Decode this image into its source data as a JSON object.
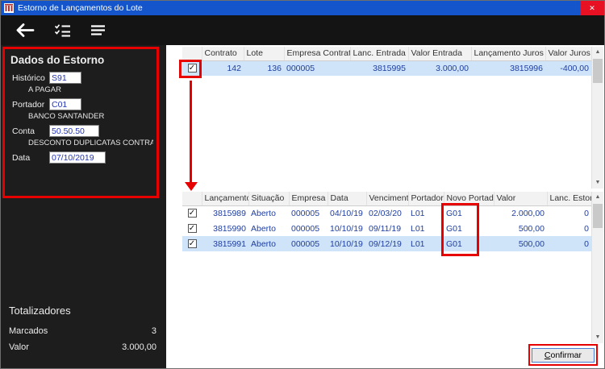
{
  "window": {
    "title": "Estorno de Lançamentos do Lote"
  },
  "icons": {
    "close": "✕",
    "check": "✓",
    "scroll_up": "▲",
    "scroll_down": "▼"
  },
  "sidebar": {
    "section_title": "Dados do Estorno",
    "fields": [
      {
        "label": "Histórico",
        "value": "S91",
        "desc": "A PAGAR"
      },
      {
        "label": "Portador",
        "value": "C01",
        "desc": "BANCO SANTANDER"
      },
      {
        "label": "Conta",
        "value": "50.50.50",
        "desc": "DESCONTO DUPLICATAS CONTRATO BAN"
      },
      {
        "label": "Data",
        "value": "07/10/2019",
        "desc": ""
      }
    ],
    "totals": {
      "title": "Totalizadores",
      "marcados_label": "Marcados",
      "marcados_value": "3",
      "valor_label": "Valor",
      "valor_value": "3.000,00"
    }
  },
  "top_grid": {
    "columns": [
      "",
      "Contrato",
      "Lote",
      "Empresa Contrato",
      "Lanc. Entrada",
      "Valor Entrada",
      "Lançamento Juros",
      "Valor Juros"
    ],
    "rows": [
      {
        "checked": true,
        "selected": true,
        "cells": [
          "142",
          "136",
          "000005",
          "3815995",
          "3.000,00",
          "3815996",
          "-400,00"
        ]
      }
    ]
  },
  "bottom_grid": {
    "columns": [
      "",
      "Lançamento",
      "Situação",
      "Empresa",
      "Data",
      "Vencimento",
      "Portador",
      "Novo Portador",
      "Valor",
      "Lanc. Estorno"
    ],
    "rows": [
      {
        "checked": true,
        "selected": false,
        "cells": [
          "3815989",
          "Aberto",
          "000005",
          "04/10/19",
          "02/03/20",
          "L01",
          "G01",
          "2.000,00",
          "0"
        ]
      },
      {
        "checked": true,
        "selected": false,
        "cells": [
          "3815990",
          "Aberto",
          "000005",
          "10/10/19",
          "09/11/19",
          "L01",
          "G01",
          "500,00",
          "0"
        ]
      },
      {
        "checked": true,
        "selected": true,
        "cells": [
          "3815991",
          "Aberto",
          "000005",
          "10/10/19",
          "09/12/19",
          "L01",
          "G01",
          "500,00",
          "0"
        ]
      }
    ]
  },
  "footer": {
    "confirm_accel": "C",
    "confirm_rest": "onfirmar"
  },
  "colors": {
    "titlebar": "#1455cc",
    "close_button": "#e81123",
    "annotation_red": "#e60000",
    "row_selection": "#cfe4f9",
    "grid_value_text": "#1f3ea0",
    "sidebar_bg": "#1d1d1d",
    "toolbar_bg": "#141414"
  }
}
